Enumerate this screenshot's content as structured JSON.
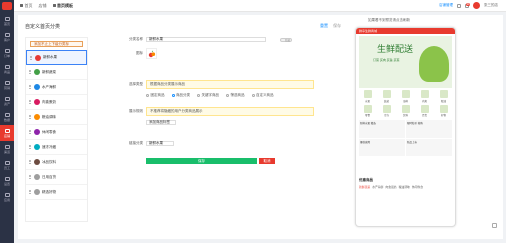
{
  "sidebar": {
    "items": [
      {
        "label": "首页"
      },
      {
        "label": "客户"
      },
      {
        "label": "订单"
      },
      {
        "label": "商品"
      },
      {
        "label": "营销"
      },
      {
        "label": "资产"
      },
      {
        "label": "数据"
      },
      {
        "label": "店铺"
      },
      {
        "label": "渠道"
      },
      {
        "label": "员工"
      },
      {
        "label": "设置"
      },
      {
        "label": "应用"
      }
    ],
    "active_index": 7
  },
  "topbar": {
    "breadcrumbs": [
      "首页",
      "店铺",
      "首页模板"
    ],
    "right": {
      "store_label": "店铺管理",
      "msg_count": "99",
      "user": "张三的店"
    }
  },
  "panel": {
    "title": "自定义首页分类",
    "links": [
      "重置",
      "保存"
    ]
  },
  "category_list": {
    "add_label": "添加不止上下级分类标",
    "items": [
      "新鲜水果",
      "新鲜蔬菜",
      "水产海鲜",
      "肉禽蛋奶",
      "粮油调味",
      "休闲零食",
      "速冻冷藏",
      "冰品饮料",
      "日用百货",
      "精选好物"
    ],
    "active_index": 0
  },
  "form": {
    "name_label": "分类名称",
    "name_value": "新鲜水果",
    "toggle_text": "隐藏",
    "icon_label": "图标",
    "type_label": "选择类型",
    "type_note": "根据商品分类展示商品",
    "type_options": [
      "固定商品",
      "商品分类",
      "关键字商品",
      "筛选商品",
      "自定义商品"
    ],
    "type_selected": 1,
    "display_label": "展示规则",
    "display_note": "不推荐将隐藏的用户分类商品展示",
    "display_button": "添加商品标签",
    "link_label": "链接分类",
    "link_value": "新鲜水果",
    "save_label": "保存",
    "cancel_label": "取消"
  },
  "phone": {
    "header": "鲜享生鲜商城",
    "top_info": "如果看不到预览请点击刷新",
    "banner_title": "生鲜配送",
    "banner_sub": "订菜 买肉 买鱼 买菜",
    "cats": [
      "水果",
      "蔬菜",
      "海鲜",
      "肉禽",
      "粮油",
      "零食",
      "冷冻",
      "饮料",
      "百货",
      "好物"
    ],
    "promos": [
      "新鲜水果 精选",
      "限时秒杀 抢购",
      "爆款直降",
      "新品上市"
    ],
    "tab_title": "优惠商品",
    "subtabs": [
      "新鲜蔬菜",
      "水产海鲜",
      "肉禽蛋奶",
      "粮油调味",
      "休闲零食"
    ],
    "subtab_active": 0
  },
  "colors": {
    "accent": "#e83a2e",
    "primary": "#1890ff",
    "save_btn": "#19be6b"
  }
}
